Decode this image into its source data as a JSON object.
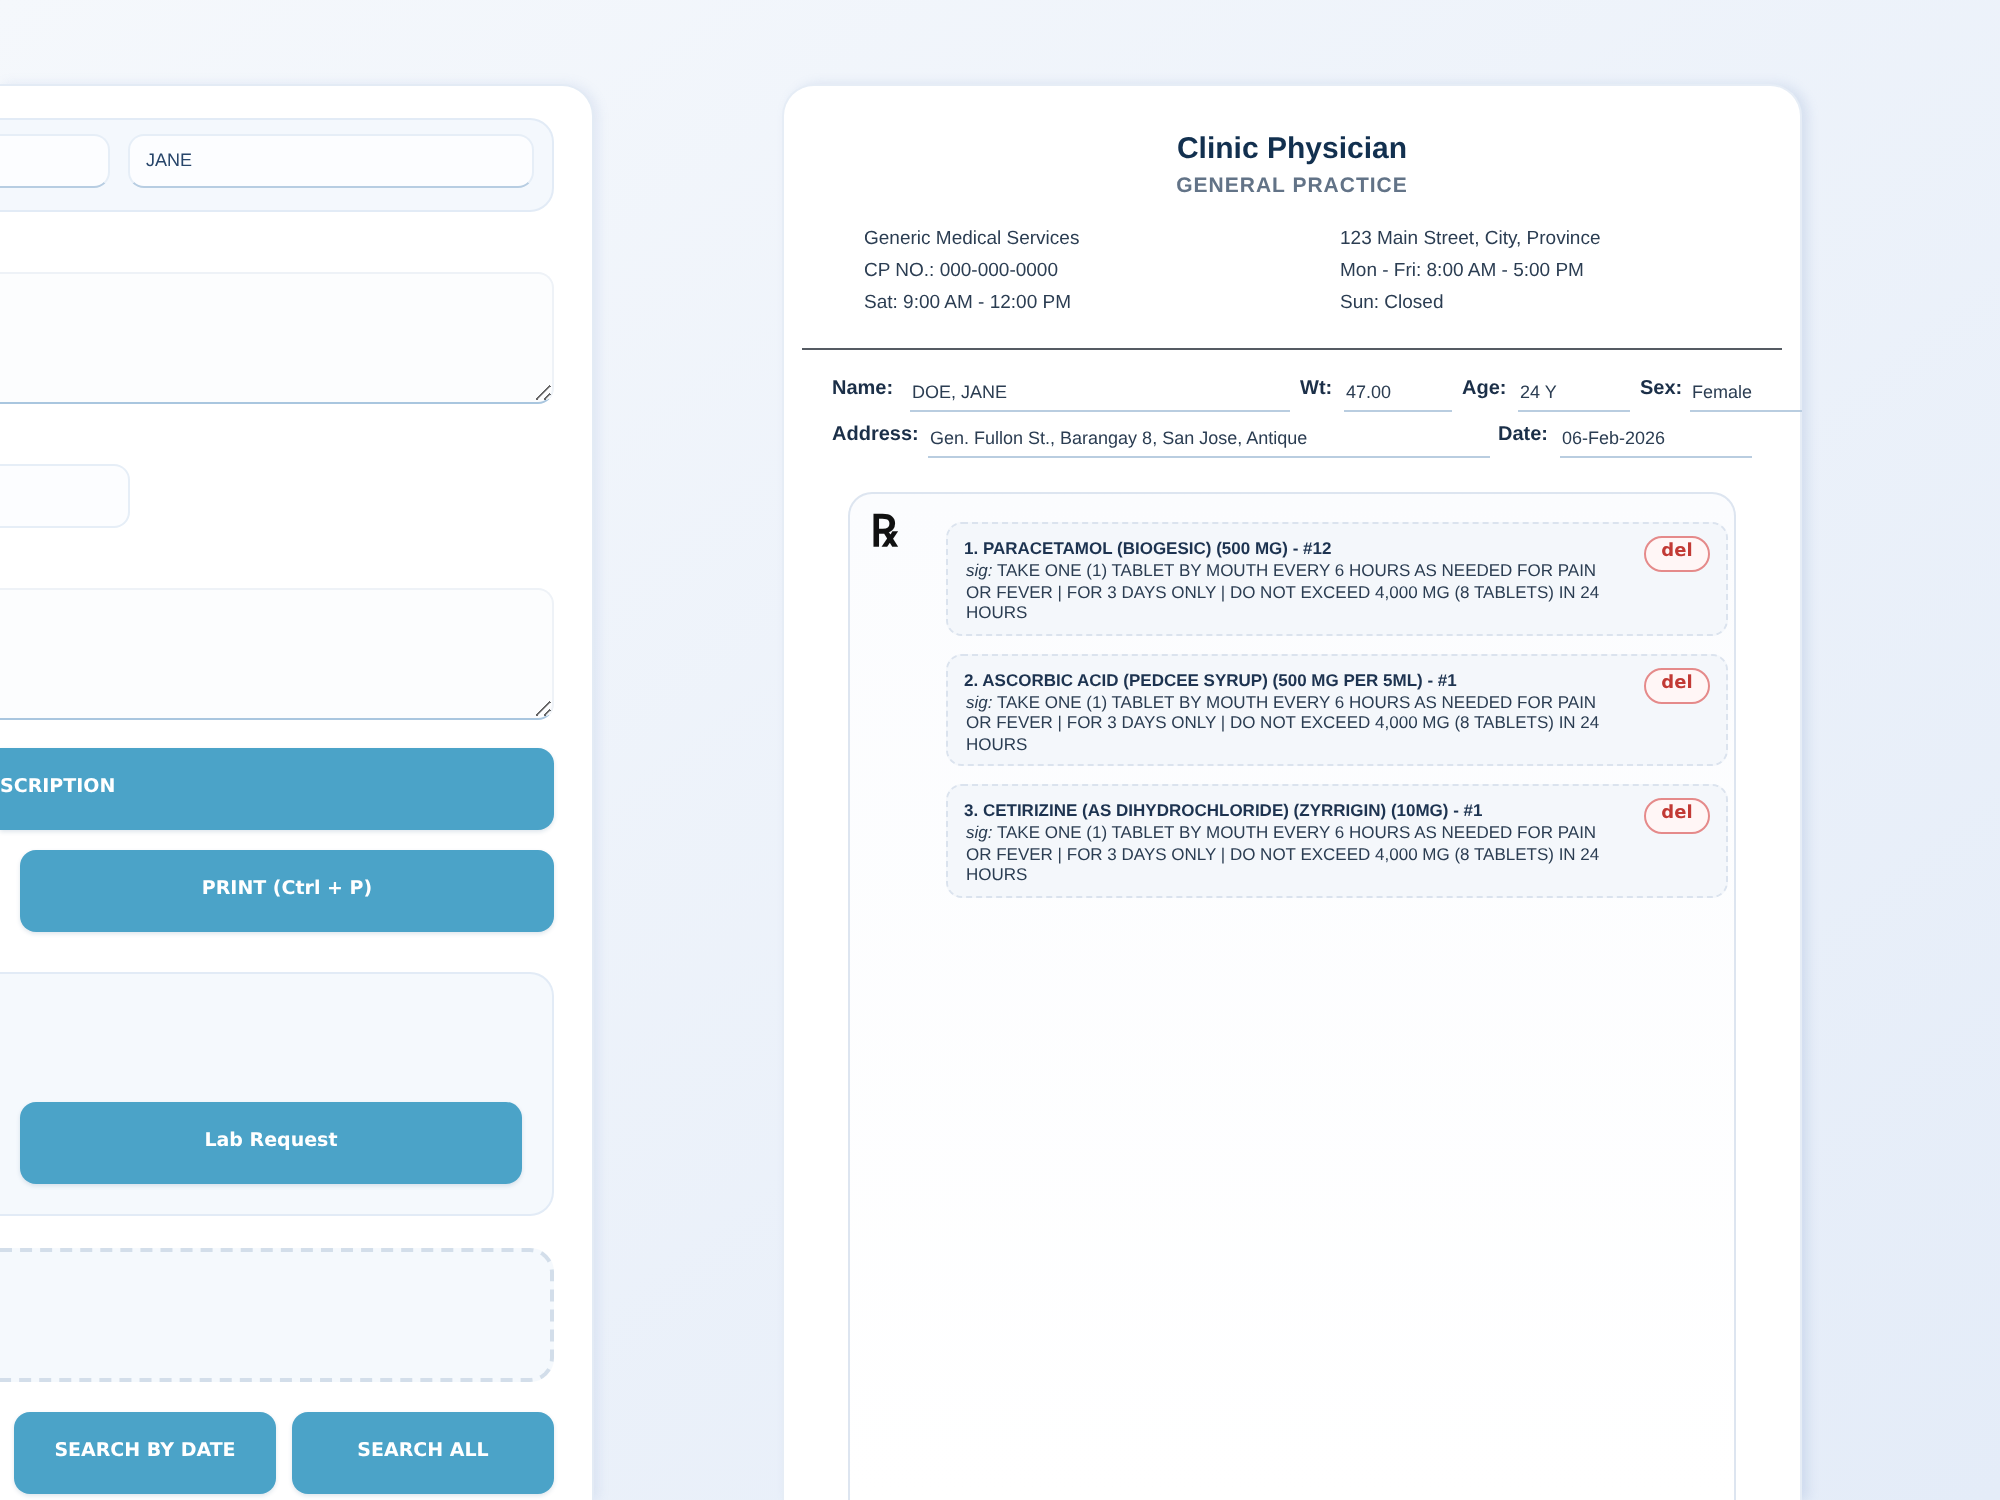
{
  "form_panel": {
    "items": [
      {
        "kind": "pair",
        "inputs": [
          {
            "kind": "input"
          },
          {
            "kind": "input",
            "value": "JANE"
          }
        ]
      },
      {
        "kind": "textarea"
      },
      {
        "kind": "input"
      },
      {
        "kind": "textarea"
      },
      {
        "kind": "cta",
        "label": "SCRIPTION"
      },
      {
        "kind": "button",
        "label": "PRINT (Ctrl + P)"
      },
      {
        "kind": "group",
        "label": "Lab Request"
      },
      {
        "kind": "dropzone"
      },
      {
        "kind": "buttons",
        "labels": [
          "SEARCH BY DATE",
          "SEARCH ALL"
        ]
      }
    ]
  },
  "prescription": {
    "title": "Clinic Physician",
    "subtitle": "GENERAL PRACTICE",
    "info_left": [
      "Generic Medical Services",
      "CP NO.: 000-000-0000",
      "Sat: 9:00 AM - 12:00 PM"
    ],
    "info_right": [
      "123 Main Street, City, Province",
      "Mon - Fri: 8:00 AM - 5:00 PM",
      "Sun: Closed"
    ],
    "patient_rows": [
      [
        {
          "label": "Name:",
          "value": "DOE, JANE"
        },
        {
          "label": "Wt:",
          "value": "47.00"
        },
        {
          "label": "Age:",
          "value": "24 Y"
        },
        {
          "label": "Sex:",
          "value": "Female"
        }
      ],
      [
        {
          "label": "Address:",
          "value": "Gen. Fullon St., Barangay 8, San Jose, Antique"
        },
        {
          "label": "Date:",
          "value": "06-Feb-2026"
        }
      ]
    ],
    "rx_symbol": "℞",
    "items": [
      {
        "title": "1. PARACETAMOL (BIOGESIC) (500 MG) - #12",
        "sig": "*sig:* TAKE ONE (1) TABLET BY MOUTH EVERY 6 HOURS AS NEEDED FOR PAIN OR FEVER | FOR 3 DAYS ONLY | DO NOT EXCEED 4,000 MG (8 TABLETS) IN 24 HOURS",
        "action": "del"
      },
      {
        "title": "2. ASCORBIC ACID (PEDCEE SYRUP) (500 MG PER 5ML) - #1",
        "sig": "*sig:* TAKE ONE (1) TABLET BY MOUTH EVERY 6 HOURS AS NEEDED FOR PAIN OR FEVER | FOR 3 DAYS ONLY | DO NOT EXCEED 4,000 MG (8 TABLETS) IN 24 HOURS",
        "action": "del"
      },
      {
        "title": "3. CETIRIZINE (AS DIHYDROCHLORIDE) (ZYRRIGIN) (10MG) - #1",
        "sig": "*sig:* TAKE ONE (1) TABLET BY MOUTH EVERY 6 HOURS AS NEEDED FOR PAIN OR FEVER | FOR 3 DAYS ONLY | DO NOT EXCEED 4,000 MG (8 TABLETS) IN 24 HOURS",
        "action": "del"
      }
    ]
  }
}
